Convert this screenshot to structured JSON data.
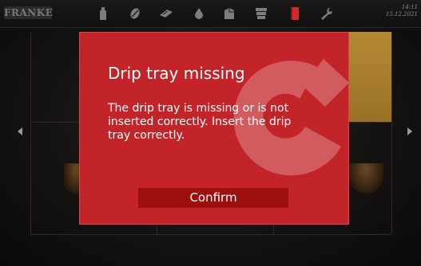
{
  "header": {
    "logo_text": "FRANKE",
    "time": "14:11",
    "date": "15.12.2021",
    "icons": [
      "bottle-icon",
      "bean-icon",
      "cleaning-tablet-icon",
      "water-drop-icon",
      "milk-pack-icon",
      "cup-stack-icon",
      "book-icon",
      "wrench-icon"
    ],
    "active_color": "#d32a2f"
  },
  "dialog": {
    "title": "Drip tray missing",
    "message": "The drip tray is missing or is not inserted correctly. Insert the drip tray correctly.",
    "confirm_label": "Confirm",
    "background_color": "#c3242a",
    "button_color": "#9e0f10"
  },
  "navigation": {
    "left_icon": "arrow-left-icon",
    "right_icon": "arrow-right-icon"
  }
}
